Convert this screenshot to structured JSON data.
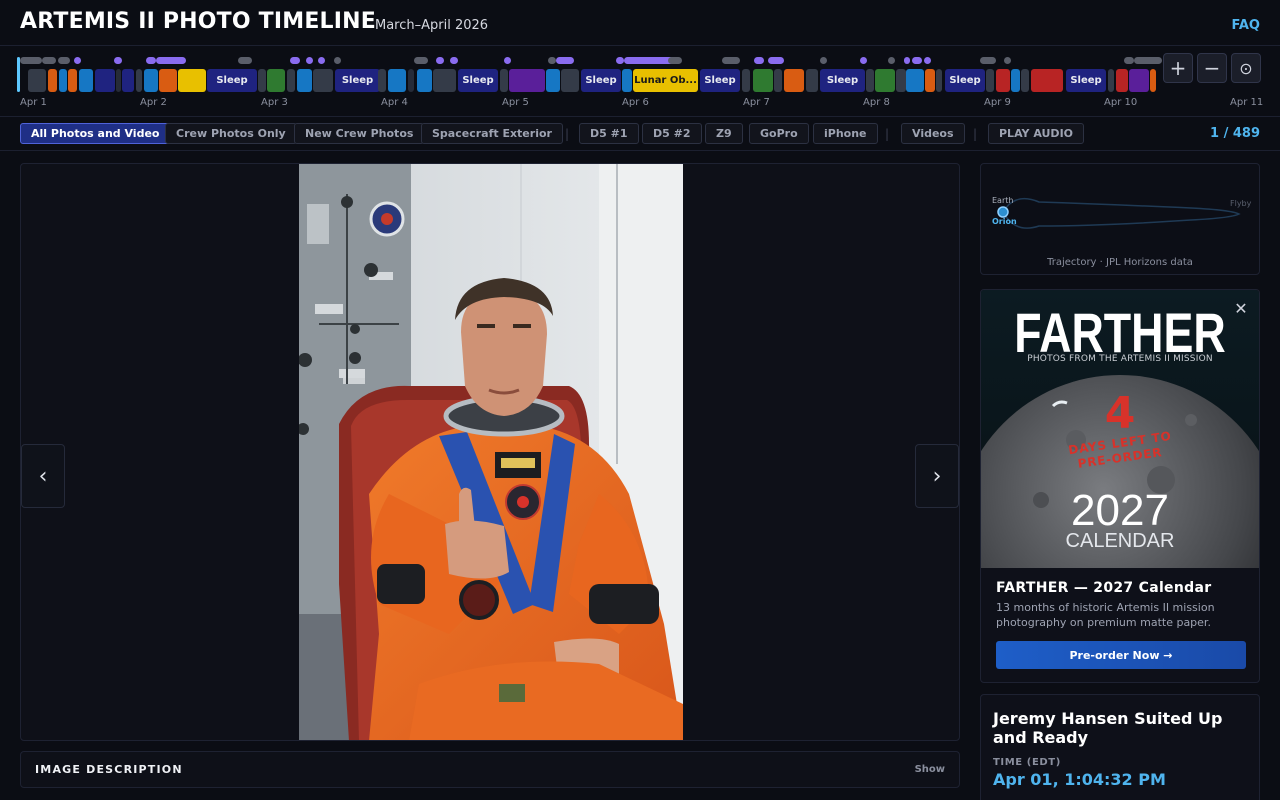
{
  "header": {
    "title": "ARTEMIS II PHOTO TIMELINE",
    "subtitle": "March–April 2026",
    "faq": "FAQ"
  },
  "timeline": {
    "days": [
      "Apr 1",
      "Apr 2",
      "Apr 3",
      "Apr 4",
      "Apr 5",
      "Apr 6",
      "Apr 7",
      "Apr 8",
      "Apr 9",
      "Apr 10",
      "Apr 11"
    ],
    "segment_labels": {
      "sleep": "Sleep",
      "lunar": "Lunar Ob..."
    },
    "zoom_in": "+",
    "zoom_out": "−",
    "reset": "⊙"
  },
  "filters": {
    "all": "All Photos and Video",
    "crew": "Crew Photos Only",
    "new_crew": "New Crew Photos",
    "exterior": "Spacecraft Exterior",
    "d5_1": "D5 #1",
    "d5_2": "D5 #2",
    "z9": "Z9",
    "gopro": "GoPro",
    "iphone": "iPhone",
    "videos": "Videos",
    "audio": "PLAY AUDIO",
    "counter": "1 / 489"
  },
  "viewer": {
    "prev": "‹",
    "next": "›",
    "description_title": "IMAGE DESCRIPTION",
    "description_toggle": "Show"
  },
  "trajectory": {
    "earth": "Earth",
    "orion": "Orion",
    "flyby": "Flyby",
    "caption": "Trajectory · JPL Horizons data"
  },
  "ad": {
    "art_title": "FARTHER",
    "art_subtitle": "PHOTOS FROM THE ARTEMIS II MISSION",
    "countdown": "4",
    "countdown_text_1": "DAYS LEFT TO",
    "countdown_text_2": "PRE-ORDER",
    "year": "2027",
    "calendar": "CALENDAR",
    "title": "FARTHER — 2027 Calendar",
    "text": "13 months of historic Artemis II mission photography on premium matte paper.",
    "button": "Pre-order Now →",
    "close": "✕"
  },
  "photo_info": {
    "title": "Jeremy Hansen Suited Up and Ready",
    "time_label": "TIME (EDT)",
    "time": "Apr 01, 1:04:32 PM"
  },
  "colors": {
    "accent": "#4fb4ee",
    "filter_active": "#1f2f86",
    "sleep": "#1f2380",
    "lunar": "#e8c000",
    "preorder": "#1e5ec8"
  }
}
